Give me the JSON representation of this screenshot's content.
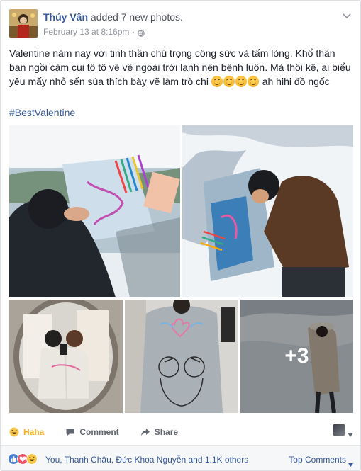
{
  "post": {
    "author": "Thúy Vân",
    "action": "added 7 new photos.",
    "timestamp": "February 13 at 8:16pm",
    "separator": "·",
    "privacy_icon": "globe-icon",
    "options_icon": "chevron-down-icon",
    "text": "Valentine năm nay với tinh thần chú trọng công sức và tấm lòng. Khổ thân bạn ngồi cặm cụi tô tô vẽ vẽ ngoài trời lạnh nên bệnh luôn. Mà thôi kệ, ai biểu yêu mấy nhỏ sến súa thích bày vẽ làm trò chi",
    "text_tail": "ah hihi đồ ngốc",
    "emoji_icon": "grinning-face-emoji",
    "hashtag": "#BestValentine",
    "more_photos": "+3"
  },
  "actions": {
    "reaction_label": "Haha",
    "reaction_icon": "haha-emoji-icon",
    "comment_label": "Comment",
    "comment_icon": "comment-icon",
    "share_label": "Share",
    "share_icon": "share-icon"
  },
  "summary": {
    "reaction_icons": [
      "like-icon",
      "love-icon",
      "haha-icon"
    ],
    "text": "You, Thanh Châu, Đức Khoa Nguyễn and 1.1K others",
    "top_comments": "Top Comments"
  },
  "colors": {
    "link": "#365899",
    "haha": "#f7b125",
    "muted": "#90949c"
  }
}
